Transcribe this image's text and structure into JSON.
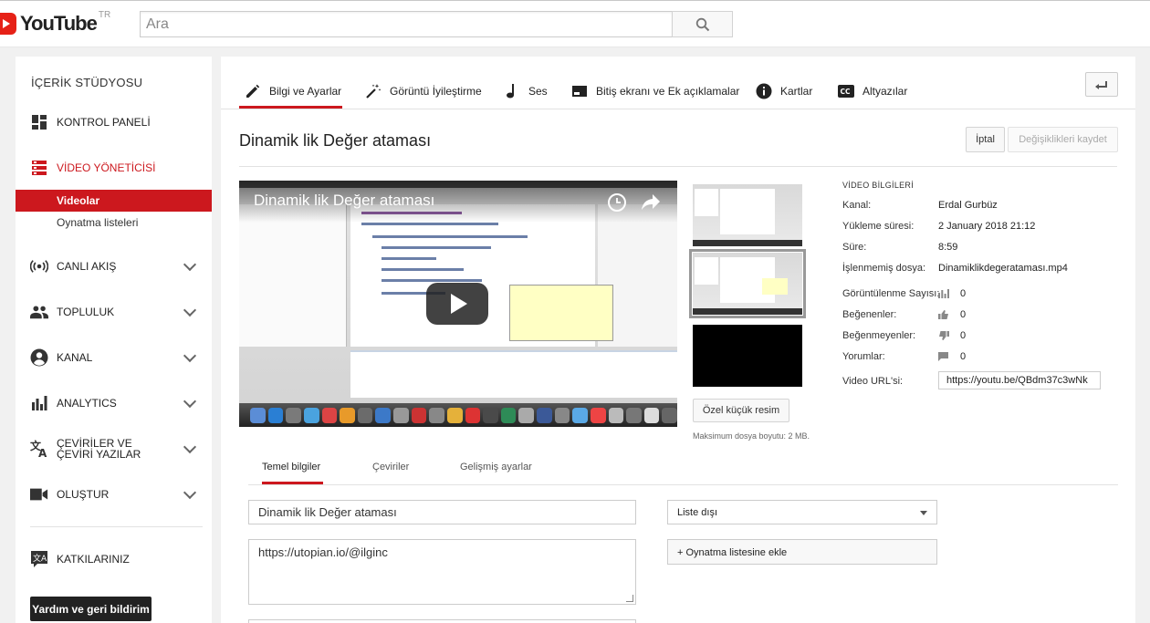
{
  "header": {
    "logo_text": "YouTube",
    "logo_region": "TR",
    "search_placeholder": "Ara"
  },
  "sidebar": {
    "title": "İÇERİK STÜDYOSU",
    "items": [
      {
        "label": "KONTROL PANELİ",
        "icon": "dashboard-icon"
      },
      {
        "label": "VİDEO YÖNETİCİSİ",
        "icon": "video-manager-icon",
        "active": true
      },
      {
        "label": "CANLI AKIŞ",
        "icon": "live-icon"
      },
      {
        "label": "TOPLULUK",
        "icon": "community-icon"
      },
      {
        "label": "KANAL",
        "icon": "channel-icon"
      },
      {
        "label": "ANALYTICS",
        "icon": "analytics-icon"
      },
      {
        "label": "ÇEVİRİLER VE ÇEVİRİ YAZILAR",
        "icon": "translate-icon"
      },
      {
        "label": "OLUŞTUR",
        "icon": "create-icon"
      },
      {
        "label": "KATKILARINIZ",
        "icon": "contributions-icon"
      }
    ],
    "subitems": {
      "videos": "Videolar",
      "playlists": "Oynatma listeleri"
    },
    "help_button": "Yardım ve geri bildirim"
  },
  "tabs": [
    {
      "label": "Bilgi ve Ayarlar",
      "icon": "pencil-icon",
      "selected": true
    },
    {
      "label": "Görüntü İyileştirme",
      "icon": "wand-icon"
    },
    {
      "label": "Ses",
      "icon": "music-note-icon"
    },
    {
      "label": "Bitiş ekranı ve Ek açıklamalar",
      "icon": "end-screen-icon"
    },
    {
      "label": "Kartlar",
      "icon": "info-icon"
    },
    {
      "label": "Altyazılar",
      "icon": "cc-icon"
    }
  ],
  "video": {
    "title": "Dinamik lik Değer ataması",
    "player_title": "Dinamik lik Değer ataması",
    "cancel_button": "İptal",
    "save_button": "Değişiklikleri kaydet",
    "custom_thumb_button": "Özel küçük resim",
    "max_size": "Maksimum dosya boyutu: 2 MB."
  },
  "info": {
    "heading": "VİDEO BİLGİLERİ",
    "channel_label": "Kanal:",
    "channel": "Erdal Gurbüz",
    "upload_label": "Yükleme süresi:",
    "upload_time": "2 January 2018 21:12",
    "duration_label": "Süre:",
    "duration": "8:59",
    "raw_file_label": "İşlenmemiş dosya:",
    "raw_file": "Dinamiklikdegerataması.mp4",
    "views_label": "Görüntülenme Sayısı:",
    "views": "0",
    "likes_label": "Beğenenler:",
    "likes": "0",
    "dislikes_label": "Beğenmeyenler:",
    "dislikes": "0",
    "comments_label": "Yorumlar:",
    "comments": "0",
    "url_label": "Video URL'si:",
    "url": "https://youtu.be/QBdm37c3wNk"
  },
  "subtabs": {
    "basic": "Temel bilgiler",
    "translations": "Çeviriler",
    "advanced": "Gelişmiş ayarlar"
  },
  "form": {
    "title_value": "Dinamik lik Değer ataması",
    "description_value": "https://utopian.io/@ilginc",
    "privacy_value": "Liste dışı",
    "add_playlist": "+ Oynatma listesine ekle"
  },
  "colors": {
    "accent": "#cc181e",
    "logo_red": "#e62117"
  }
}
